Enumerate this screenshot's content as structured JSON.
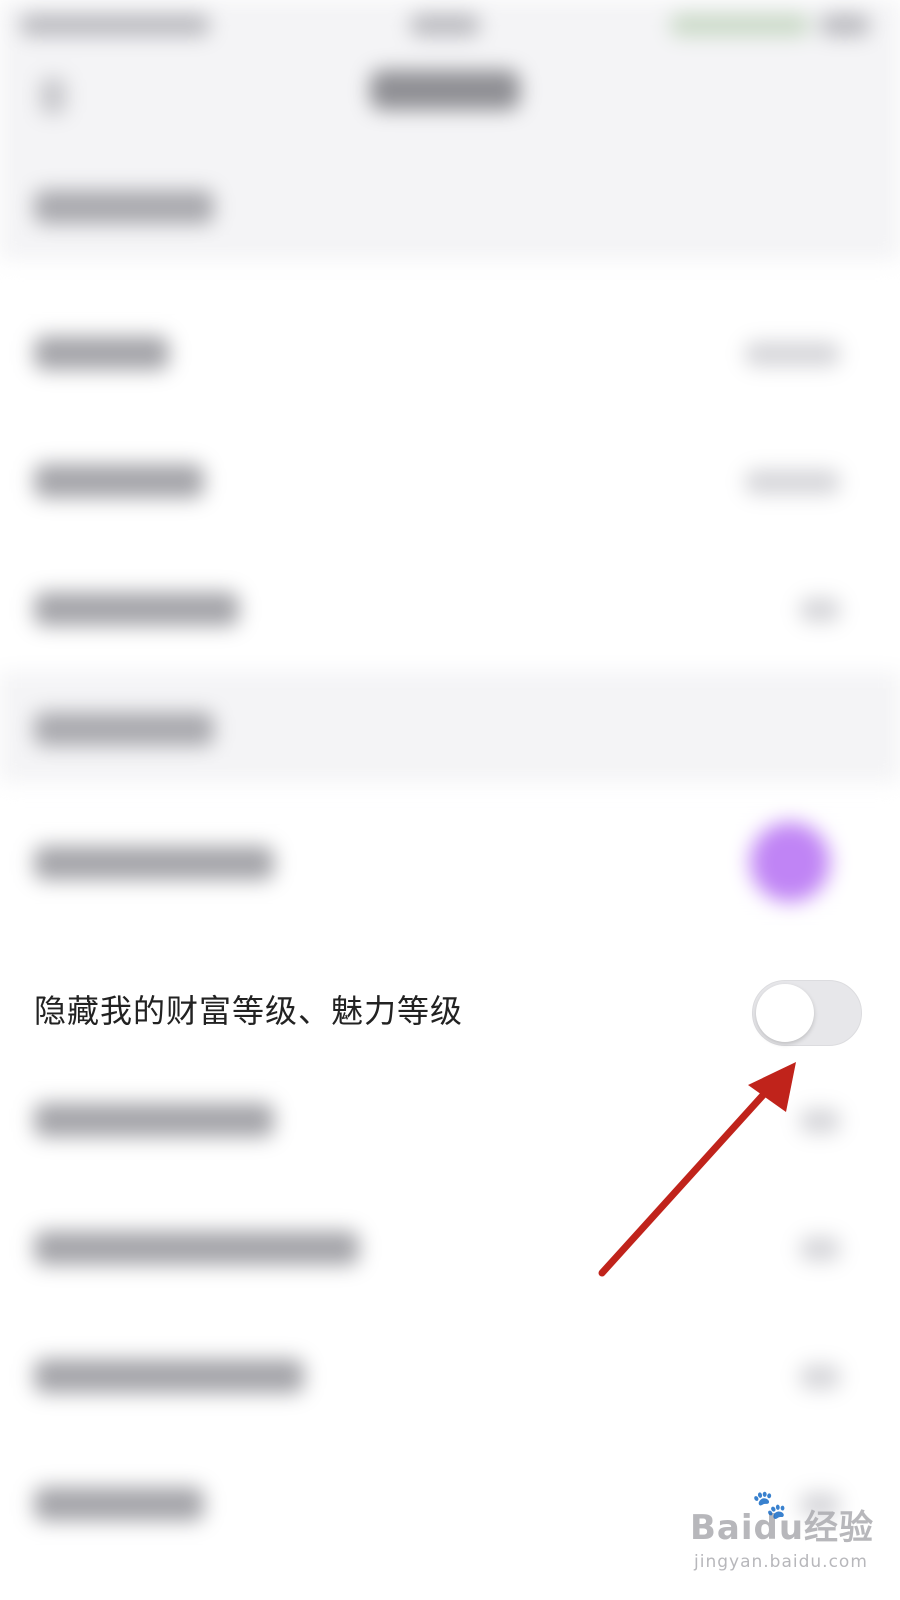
{
  "privacy": {
    "hide_level_label": "隐藏我的财富等级、魅力等级",
    "hide_level_toggle": "off"
  },
  "annotation": {
    "arrow_color": "#c0231b"
  },
  "colors": {
    "toggle_track": "#e7e7ea",
    "toggle_knob": "#ffffff",
    "section_bg": "#f4f4f6",
    "accent_purple": "#c084f5"
  },
  "watermark": {
    "brand": "Baidu经验",
    "url": "jingyan.baidu.com"
  }
}
